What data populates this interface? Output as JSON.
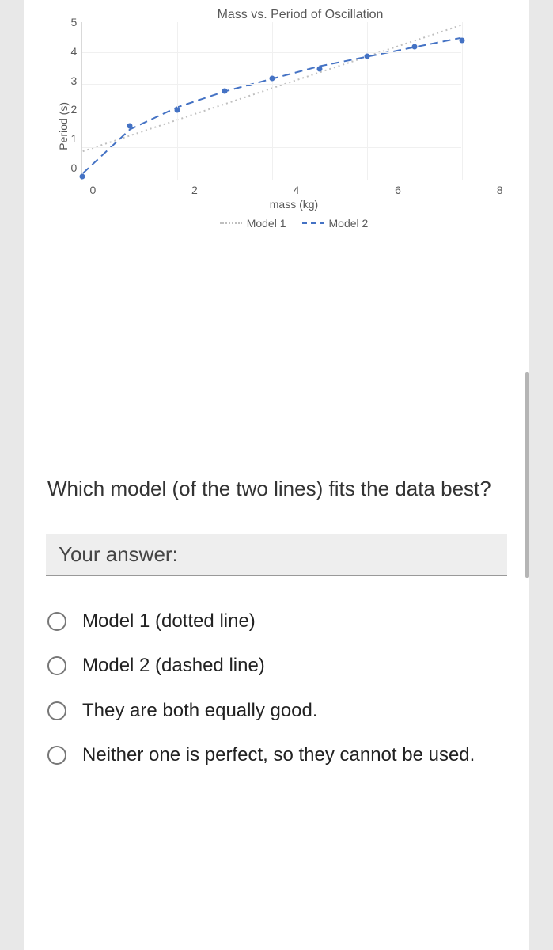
{
  "chart_data": {
    "type": "scatter",
    "title": "Mass vs. Period of Oscillation",
    "xlabel": "mass (kg)",
    "ylabel": "Period (s)",
    "xlim": [
      0,
      8
    ],
    "ylim": [
      0,
      5
    ],
    "xticks": [
      "0",
      "2",
      "4",
      "6",
      "8"
    ],
    "yticks": [
      "5",
      "4",
      "3",
      "2",
      "1",
      "0"
    ],
    "data_points": [
      {
        "x": 0.0,
        "y": 0.1
      },
      {
        "x": 1.0,
        "y": 1.7
      },
      {
        "x": 2.0,
        "y": 2.2
      },
      {
        "x": 3.0,
        "y": 2.8
      },
      {
        "x": 4.0,
        "y": 3.2
      },
      {
        "x": 5.0,
        "y": 3.5
      },
      {
        "x": 6.0,
        "y": 3.9
      },
      {
        "x": 7.0,
        "y": 4.2
      },
      {
        "x": 8.0,
        "y": 4.4
      }
    ],
    "series": [
      {
        "name": "Model 1",
        "style": "dotted",
        "color": "#BFBFBF",
        "points": [
          {
            "x": 0.0,
            "y": 0.9
          },
          {
            "x": 1.0,
            "y": 1.4
          },
          {
            "x": 2.0,
            "y": 1.9
          },
          {
            "x": 3.0,
            "y": 2.4
          },
          {
            "x": 4.0,
            "y": 2.9
          },
          {
            "x": 5.0,
            "y": 3.4
          },
          {
            "x": 6.0,
            "y": 3.9
          },
          {
            "x": 7.0,
            "y": 4.4
          },
          {
            "x": 8.0,
            "y": 4.9
          }
        ]
      },
      {
        "name": "Model 2",
        "style": "dashed",
        "color": "#4472C4",
        "points": [
          {
            "x": 0.0,
            "y": 0.2
          },
          {
            "x": 1.0,
            "y": 1.6
          },
          {
            "x": 2.0,
            "y": 2.3
          },
          {
            "x": 3.0,
            "y": 2.8
          },
          {
            "x": 4.0,
            "y": 3.2
          },
          {
            "x": 5.0,
            "y": 3.6
          },
          {
            "x": 6.0,
            "y": 3.9
          },
          {
            "x": 7.0,
            "y": 4.2
          },
          {
            "x": 8.0,
            "y": 4.5
          }
        ]
      }
    ],
    "legend": [
      {
        "label": "Model 1"
      },
      {
        "label": "Model 2"
      }
    ]
  },
  "question": "Which model (of the two lines) fits the data best?",
  "answer_header": "Your answer:",
  "options": [
    "Model 1 (dotted line)",
    "Model 2 (dashed line)",
    "They are both equally good.",
    "Neither one is perfect, so they cannot be used."
  ]
}
